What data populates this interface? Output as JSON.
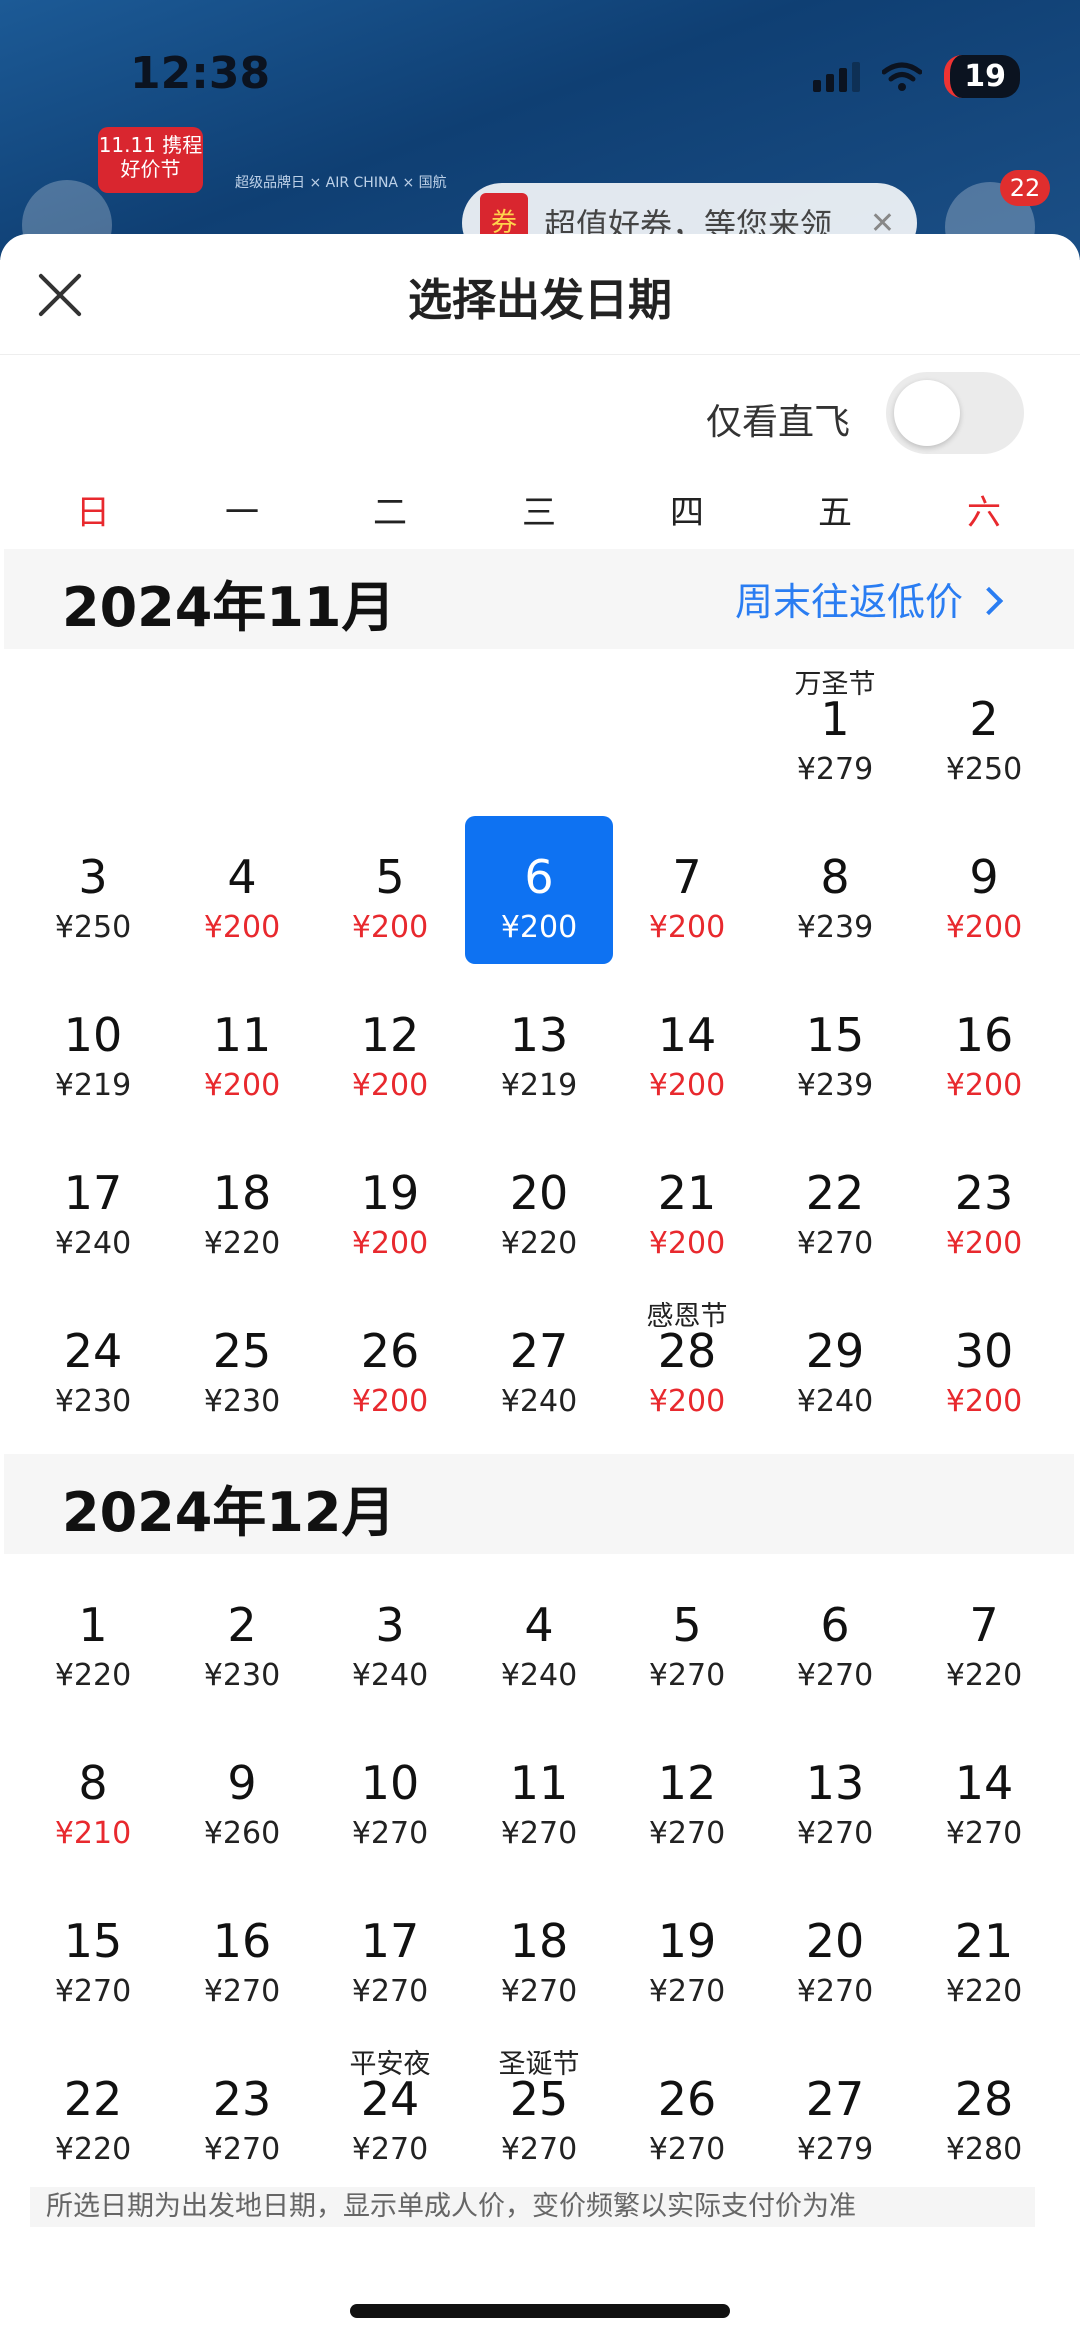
{
  "status_bar": {
    "time": "12:38",
    "battery": "19"
  },
  "background": {
    "promo_badge": "11.11 携程好价节",
    "partner_logos": "超级品牌日 × AIR CHINA × 国航",
    "coupon_text": "超值好券，等您来领",
    "coupon_icon_text": "券",
    "more_badge": "22"
  },
  "sheet": {
    "title": "选择出发日期"
  },
  "filter": {
    "label": "仅看直飞",
    "direct_only": false
  },
  "weekdays": [
    "日",
    "一",
    "二",
    "三",
    "四",
    "五",
    "六"
  ],
  "months": [
    {
      "title": "2024年11月",
      "link": "周末往返低价",
      "first_weekday": 5,
      "days": [
        {
          "day": "1",
          "price": "¥279",
          "holiday": "万圣节",
          "low": false
        },
        {
          "day": "2",
          "price": "¥250",
          "low": false
        },
        {
          "day": "3",
          "price": "¥250",
          "low": false
        },
        {
          "day": "4",
          "price": "¥200",
          "low": true
        },
        {
          "day": "5",
          "price": "¥200",
          "low": true
        },
        {
          "day": "6",
          "price": "¥200",
          "low": true,
          "selected": true
        },
        {
          "day": "7",
          "price": "¥200",
          "low": true
        },
        {
          "day": "8",
          "price": "¥239",
          "low": false
        },
        {
          "day": "9",
          "price": "¥200",
          "low": true
        },
        {
          "day": "10",
          "price": "¥219",
          "low": false
        },
        {
          "day": "11",
          "price": "¥200",
          "low": true
        },
        {
          "day": "12",
          "price": "¥200",
          "low": true
        },
        {
          "day": "13",
          "price": "¥219",
          "low": false
        },
        {
          "day": "14",
          "price": "¥200",
          "low": true
        },
        {
          "day": "15",
          "price": "¥239",
          "low": false
        },
        {
          "day": "16",
          "price": "¥200",
          "low": true
        },
        {
          "day": "17",
          "price": "¥240",
          "low": false
        },
        {
          "day": "18",
          "price": "¥220",
          "low": false
        },
        {
          "day": "19",
          "price": "¥200",
          "low": true
        },
        {
          "day": "20",
          "price": "¥220",
          "low": false
        },
        {
          "day": "21",
          "price": "¥200",
          "low": true
        },
        {
          "day": "22",
          "price": "¥270",
          "low": false
        },
        {
          "day": "23",
          "price": "¥200",
          "low": true
        },
        {
          "day": "24",
          "price": "¥230",
          "low": false
        },
        {
          "day": "25",
          "price": "¥230",
          "low": false
        },
        {
          "day": "26",
          "price": "¥200",
          "low": true
        },
        {
          "day": "27",
          "price": "¥240",
          "low": false
        },
        {
          "day": "28",
          "price": "¥200",
          "holiday": "感恩节",
          "low": true
        },
        {
          "day": "29",
          "price": "¥240",
          "low": false
        },
        {
          "day": "30",
          "price": "¥200",
          "low": true
        }
      ]
    },
    {
      "title": "2024年12月",
      "link": "",
      "first_weekday": 0,
      "days": [
        {
          "day": "1",
          "price": "¥220",
          "low": false
        },
        {
          "day": "2",
          "price": "¥230",
          "low": false
        },
        {
          "day": "3",
          "price": "¥240",
          "low": false
        },
        {
          "day": "4",
          "price": "¥240",
          "low": false
        },
        {
          "day": "5",
          "price": "¥270",
          "low": false
        },
        {
          "day": "6",
          "price": "¥270",
          "low": false
        },
        {
          "day": "7",
          "price": "¥220",
          "low": false
        },
        {
          "day": "8",
          "price": "¥210",
          "low": true
        },
        {
          "day": "9",
          "price": "¥260",
          "low": false
        },
        {
          "day": "10",
          "price": "¥270",
          "low": false
        },
        {
          "day": "11",
          "price": "¥270",
          "low": false
        },
        {
          "day": "12",
          "price": "¥270",
          "low": false
        },
        {
          "day": "13",
          "price": "¥270",
          "low": false
        },
        {
          "day": "14",
          "price": "¥270",
          "low": false
        },
        {
          "day": "15",
          "price": "¥270",
          "low": false
        },
        {
          "day": "16",
          "price": "¥270",
          "low": false
        },
        {
          "day": "17",
          "price": "¥270",
          "low": false
        },
        {
          "day": "18",
          "price": "¥270",
          "low": false
        },
        {
          "day": "19",
          "price": "¥270",
          "low": false
        },
        {
          "day": "20",
          "price": "¥270",
          "low": false
        },
        {
          "day": "21",
          "price": "¥220",
          "low": false
        },
        {
          "day": "22",
          "price": "¥220",
          "low": false
        },
        {
          "day": "23",
          "price": "¥270",
          "low": false
        },
        {
          "day": "24",
          "price": "¥270",
          "holiday": "平安夜",
          "low": false
        },
        {
          "day": "25",
          "price": "¥270",
          "holiday": "圣诞节",
          "low": false
        },
        {
          "day": "26",
          "price": "¥270",
          "low": false
        },
        {
          "day": "27",
          "price": "¥279",
          "low": false
        },
        {
          "day": "28",
          "price": "¥280",
          "low": false
        }
      ]
    }
  ],
  "footer_note": "所选日期为出发地日期，显示单成人价，变价频繁以实际支付价为准",
  "colors": {
    "accent": "#0e72f2",
    "low_price": "#e8292e",
    "link": "#2a7df2"
  }
}
